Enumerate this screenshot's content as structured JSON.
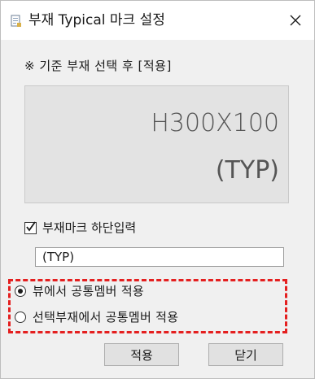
{
  "window": {
    "title": "부재 Typical 마크 설정",
    "icon": "dialog-app-icon",
    "close_icon": "close-icon"
  },
  "instruction": "※ 기준 부재 선택 후 [적용]",
  "preview": {
    "line1": "H300X100",
    "line2": "(TYP)"
  },
  "bottom_mark_option": {
    "label": "부재마크 하단입력",
    "checked": true
  },
  "bottom_mark_input": {
    "value": "(TYP)",
    "placeholder": ""
  },
  "apply_scope": {
    "options": [
      {
        "label": "뷰에서 공통멤버 적용",
        "selected": true
      },
      {
        "label": "선택부재에서 공통멤버 적용",
        "selected": false
      }
    ],
    "highlight_color": "#e41f1f"
  },
  "buttons": {
    "apply": "적용",
    "close": "닫기"
  }
}
